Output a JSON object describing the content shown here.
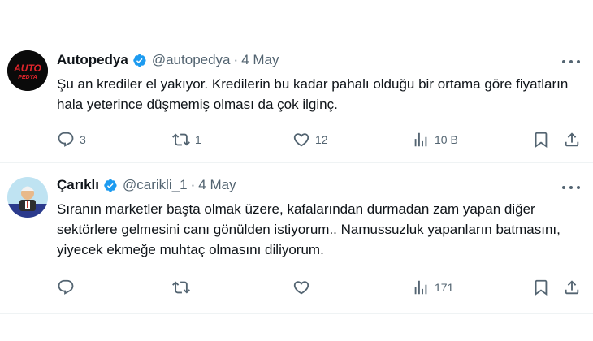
{
  "tweets": [
    {
      "name": "Autopedya",
      "handle": "@autopedya",
      "date": "4 May",
      "avatar_text": "AUTO PEDYA",
      "text": "Şu an krediler el yakıyor. Kredilerin bu kadar pahalı olduğu bir ortama göre fiyatların hala yeterince düşmemiş olması da çok ilginç.",
      "replies": "3",
      "reposts": "1",
      "likes": "12",
      "views": "10 B"
    },
    {
      "name": "Çarıklı",
      "handle": "@carikli_1",
      "date": "4 May",
      "text": "Sıranın marketler başta olmak üzere, kafalarından durmadan zam yapan diğer sektörlere gelmesini canı gönülden istiyorum.. Namussuzluk yapanların batmasını, yiyecek ekmeğe muhtaç olmasını diliyorum.",
      "replies": "",
      "reposts": "",
      "likes": "",
      "views": "171"
    }
  ],
  "dot": "·",
  "colors": {
    "verified": "#1d9bf0",
    "muted": "#536471",
    "text": "#0f1419",
    "brand_red": "#e0252b"
  },
  "icons": [
    "reply-icon",
    "repost-icon",
    "like-icon",
    "views-icon",
    "bookmark-icon",
    "share-icon",
    "verified-badge-icon",
    "more-icon"
  ]
}
